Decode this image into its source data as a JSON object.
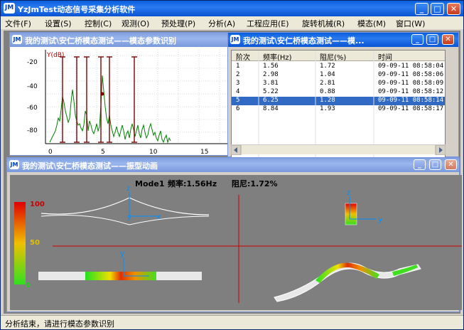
{
  "app": {
    "title": "YzJmTest动态信号采集分析软件",
    "logo_text": "JM",
    "buttons": {
      "minimize": "_",
      "maximize": "□",
      "close": "✕"
    }
  },
  "menu": [
    "文件(F)",
    "设置(S)",
    "控制(C)",
    "观测(O)",
    "预处理(P)",
    "分析(A)",
    "工程应用(E)",
    "旋转机械(R)",
    "模态(M)",
    "窗口(W)"
  ],
  "spectrum_window": {
    "title": "我的测试\\安仁桥模态测试——模态参数识别",
    "y_unit_label": "Y(dB)",
    "y_ticks": [
      "-20",
      "-40",
      "-60",
      "-80"
    ],
    "x_ticks": [
      "0",
      "5",
      "10",
      "15"
    ],
    "colors": {
      "curve": "#008000",
      "markers": "#800000",
      "grid": "#a0a0a0"
    }
  },
  "table_window": {
    "title": "我的测试\\安仁桥模态测试——模...",
    "columns": [
      "阶次",
      "频率(Hz)",
      "阻尼(%)",
      "时间"
    ],
    "rows": [
      [
        "1",
        "1.56",
        "1.72",
        "09-09-11 08:58:04"
      ],
      [
        "2",
        "2.98",
        "1.04",
        "09-09-11 08:58:06"
      ],
      [
        "3",
        "3.81",
        "2.81",
        "09-09-11 08:58:09"
      ],
      [
        "4",
        "5.22",
        "0.88",
        "09-09-11 08:58:12"
      ],
      [
        "5",
        "6.25",
        "1.28",
        "09-09-11 08:58:14"
      ],
      [
        "6",
        "8.84",
        "1.93",
        "09-09-11 08:58:17"
      ]
    ],
    "selected_row": 4,
    "selection_color": "#316ac5"
  },
  "animation_window": {
    "title": "我的测试\\安仁桥模态测试——振型动画",
    "mode_label": "Mode1",
    "freq_label": "频率:1.56Hz",
    "damp_label": "阻尼:1.72%",
    "scale": {
      "top": "100",
      "mid": "50",
      "bottom": "0"
    },
    "axis_labels": {
      "z": "z",
      "y": "y",
      "x": "x"
    },
    "colors": {
      "background": "#7f7f7f",
      "crosshair": "#cc0000"
    }
  },
  "status": {
    "text": "分析结束，请进行模态参数识别"
  }
}
